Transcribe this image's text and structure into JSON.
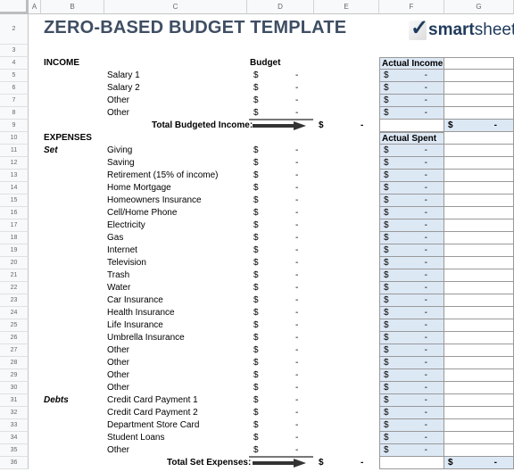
{
  "columns": [
    "A",
    "B",
    "C",
    "D",
    "E",
    "F",
    "G"
  ],
  "rows": [
    "2",
    "3",
    "4",
    "5",
    "6",
    "7",
    "8",
    "9",
    "10",
    "11",
    "12",
    "13",
    "14",
    "15",
    "16",
    "17",
    "18",
    "19",
    "20",
    "21",
    "22",
    "23",
    "24",
    "25",
    "26",
    "27",
    "28",
    "29",
    "30",
    "31",
    "32",
    "33",
    "34",
    "35",
    "36"
  ],
  "title": "ZERO-BASED BUDGET TEMPLATE",
  "logo": {
    "bold": "smart",
    "rest": "sheet"
  },
  "income": {
    "header": "INCOME",
    "budget_header": "Budget",
    "actual_header": "Actual Income",
    "items": [
      "Salary 1",
      "Salary 2",
      "Other",
      "Other"
    ],
    "total_label": "Total Budgeted Income:"
  },
  "expenses": {
    "header": "EXPENSES",
    "actual_header": "Actual Spent",
    "set_label": "Set",
    "debts_label": "Debts",
    "set_items": [
      "Giving",
      "Saving",
      "Retirement (15% of income)",
      "Home Mortgage",
      "Homeowners Insurance",
      "Cell/Home Phone",
      "Electricity",
      "Gas",
      "Internet",
      "Television",
      "Trash",
      "Water",
      "Car Insurance",
      "Health Insurance",
      "Life Insurance",
      "Umbrella Insurance",
      "Other",
      "Other",
      "Other",
      "Other"
    ],
    "debt_items": [
      "Credit Card Payment 1",
      "Credit Card Payment 2",
      "Department Store Card",
      "Student Loans",
      "Other"
    ],
    "total_label": "Total Set Expenses:"
  },
  "currency": "$",
  "empty_value": "-"
}
